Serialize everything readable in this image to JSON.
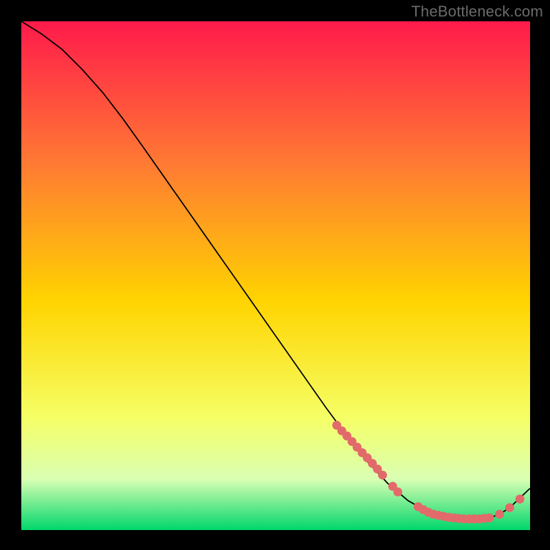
{
  "watermark": {
    "text": "TheBottleneck.com"
  },
  "colors": {
    "bg_black": "#000000",
    "grad_top": "#ff1a4b",
    "grad_mid_upper": "#ff7a33",
    "grad_mid": "#ffd400",
    "grad_mid_lower": "#f5ff66",
    "grad_lower_band": "#d9ffb3",
    "grad_bottom": "#00d66b",
    "curve": "#000000",
    "marker_fill": "#e26a6a",
    "marker_stroke": "#b44d4d"
  },
  "chart_data": {
    "type": "line",
    "title": "",
    "xlabel": "",
    "ylabel": "",
    "xlim": [
      0,
      100
    ],
    "ylim": [
      0,
      100
    ],
    "series": [
      {
        "name": "curve",
        "x": [
          0,
          4,
          8,
          12,
          16,
          20,
          24,
          28,
          32,
          36,
          40,
          44,
          48,
          52,
          56,
          60,
          64,
          68,
          72,
          76,
          80,
          82,
          84,
          86,
          88,
          90,
          92,
          94,
          96,
          100
        ],
        "y": [
          100,
          97.5,
          94.5,
          90.5,
          86,
          80.8,
          75.2,
          69.5,
          63.8,
          58.1,
          52.4,
          46.7,
          41,
          35.3,
          29.6,
          23.9,
          18.5,
          13.5,
          9.2,
          5.8,
          3.5,
          2.9,
          2.5,
          2.3,
          2.2,
          2.2,
          2.4,
          3.1,
          4.4,
          8.2
        ]
      }
    ],
    "markers": [
      {
        "x": 62.0,
        "y": 20.6
      },
      {
        "x": 63.0,
        "y": 19.5
      },
      {
        "x": 64.0,
        "y": 18.5
      },
      {
        "x": 65.0,
        "y": 17.4
      },
      {
        "x": 66.0,
        "y": 16.3
      },
      {
        "x": 67.0,
        "y": 15.2
      },
      {
        "x": 68.0,
        "y": 14.2
      },
      {
        "x": 69.0,
        "y": 13.1
      },
      {
        "x": 70.0,
        "y": 12.0
      },
      {
        "x": 71.0,
        "y": 10.8
      },
      {
        "x": 73.0,
        "y": 8.6
      },
      {
        "x": 74.0,
        "y": 7.5
      },
      {
        "x": 78.0,
        "y": 4.6
      },
      {
        "x": 79.0,
        "y": 4.0
      },
      {
        "x": 80.0,
        "y": 3.5
      },
      {
        "x": 81.0,
        "y": 3.1
      },
      {
        "x": 82.0,
        "y": 2.9
      },
      {
        "x": 83.0,
        "y": 2.7
      },
      {
        "x": 84.0,
        "y": 2.5
      },
      {
        "x": 85.0,
        "y": 2.4
      },
      {
        "x": 86.0,
        "y": 2.3
      },
      {
        "x": 87.0,
        "y": 2.2
      },
      {
        "x": 88.0,
        "y": 2.2
      },
      {
        "x": 89.0,
        "y": 2.2
      },
      {
        "x": 90.0,
        "y": 2.2
      },
      {
        "x": 91.0,
        "y": 2.3
      },
      {
        "x": 92.0,
        "y": 2.4
      },
      {
        "x": 94.0,
        "y": 3.1
      },
      {
        "x": 96.0,
        "y": 4.4
      },
      {
        "x": 98.0,
        "y": 6.1
      }
    ]
  }
}
